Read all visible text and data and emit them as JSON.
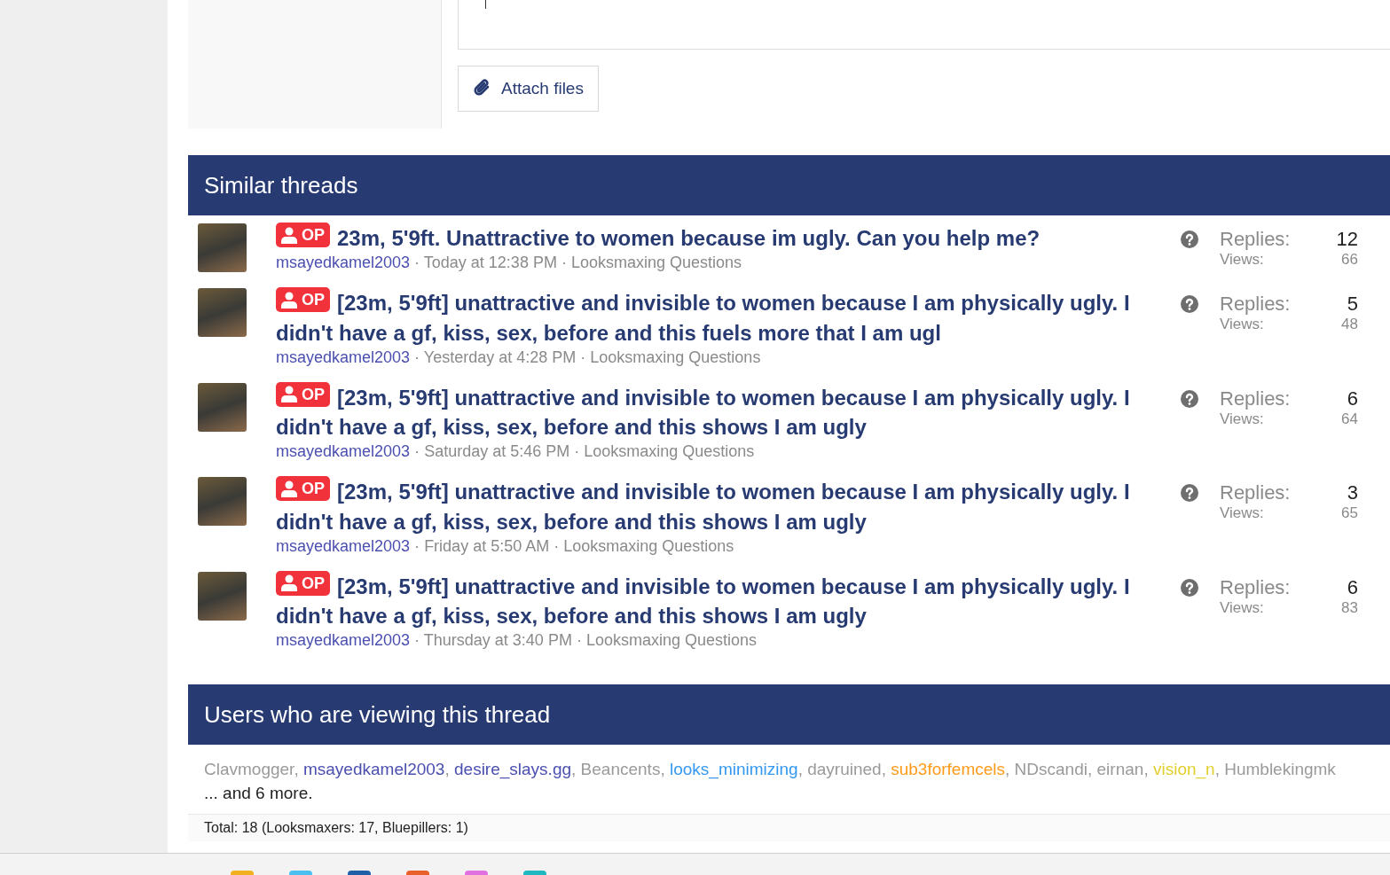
{
  "composer": {
    "attach_button": "Attach files"
  },
  "similar_threads": {
    "title": "Similar threads",
    "separator": "·",
    "threads": [
      {
        "badge": "OP",
        "title": "23m, 5'9ft. Unattractive to women because im ugly. Can you help me?",
        "author": "msayedkamel2003",
        "date": "Today at 12:38 PM",
        "forum": "Looksmaxing Questions",
        "replies_label": "Replies:",
        "replies": "12",
        "views_label": "Views:",
        "views": "66"
      },
      {
        "badge": "OP",
        "title": "[23m, 5'9ft] unattractive and invisible to women because I am physically ugly. I didn't have a gf, kiss, sex, before and this fuels more that I am ugl",
        "author": "msayedkamel2003",
        "date": "Yesterday at 4:28 PM",
        "forum": "Looksmaxing Questions",
        "replies_label": "Replies:",
        "replies": "5",
        "views_label": "Views:",
        "views": "48"
      },
      {
        "badge": "OP",
        "title": "[23m, 5'9ft] unattractive and invisible to women because I am physically ugly. I didn't have a gf, kiss, sex, before and this shows I am ugly",
        "author": "msayedkamel2003",
        "date": "Saturday at 5:46 PM",
        "forum": "Looksmaxing Questions",
        "replies_label": "Replies:",
        "replies": "6",
        "views_label": "Views:",
        "views": "64"
      },
      {
        "badge": "OP",
        "title": "[23m, 5'9ft] unattractive and invisible to women because I am physically ugly. I didn't have a gf, kiss, sex, before and this shows I am ugly",
        "author": "msayedkamel2003",
        "date": "Friday at 5:50 AM",
        "forum": "Looksmaxing Questions",
        "replies_label": "Replies:",
        "replies": "3",
        "views_label": "Views:",
        "views": "65"
      },
      {
        "badge": "OP",
        "title": "[23m, 5'9ft] unattractive and invisible to women because I am physically ugly. I didn't have a gf, kiss, sex, before and this shows I am ugly",
        "author": "msayedkamel2003",
        "date": "Thursday at 3:40 PM",
        "forum": "Looksmaxing Questions",
        "replies_label": "Replies:",
        "replies": "6",
        "views_label": "Views:",
        "views": "83"
      }
    ]
  },
  "viewers": {
    "title": "Users who are viewing this thread",
    "separator": ",",
    "users": [
      {
        "name": "Clavmogger",
        "color": "#9a9a9a"
      },
      {
        "name": "msayedkamel2003",
        "color": "#4a4fb0"
      },
      {
        "name": "desire_slays.gg",
        "color": "#4a4fb0"
      },
      {
        "name": "Beancents",
        "color": "#9a9a9a"
      },
      {
        "name": "looks_minimizing",
        "color": "#3498f0"
      },
      {
        "name": "dayruined",
        "color": "#9a9a9a"
      },
      {
        "name": "sub3forfemcels",
        "color": "#ff9a1a"
      },
      {
        "name": "NDscandi",
        "color": "#9a9a9a"
      },
      {
        "name": "eirnan",
        "color": "#9a9a9a"
      },
      {
        "name": "vision_n",
        "color": "#e2cf2e"
      },
      {
        "name": "Humblekingmk",
        "color": "#9a9a9a"
      }
    ],
    "more": "... and 6 more.",
    "total": "Total: 18 (Looksmaxers: 17, Bluepillers: 1)"
  }
}
